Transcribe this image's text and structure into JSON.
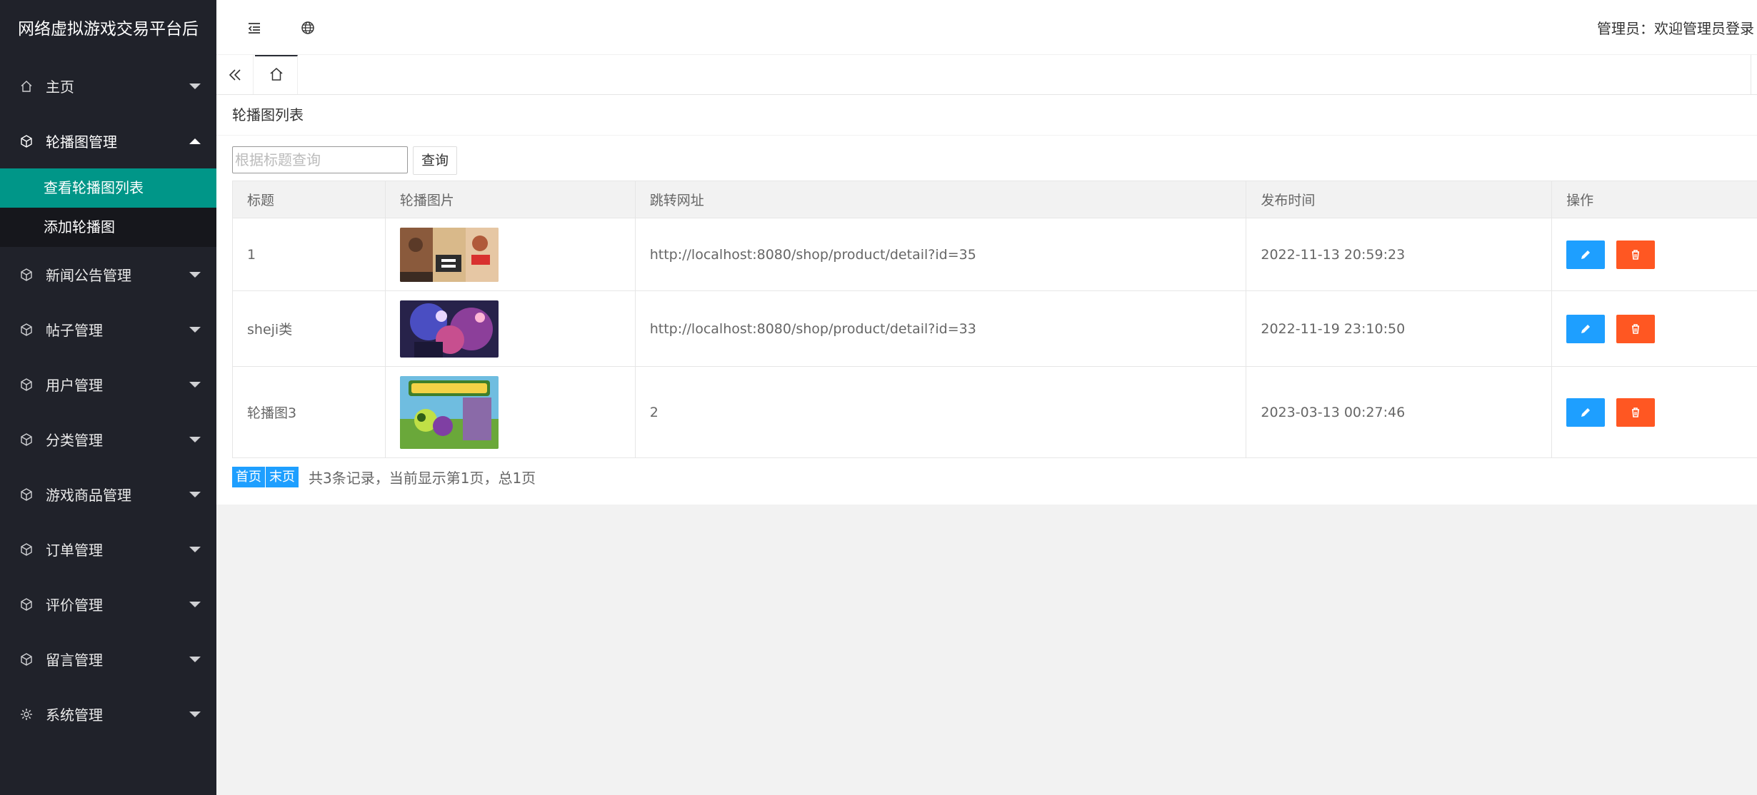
{
  "app": {
    "title": "网络虚拟游戏交易平台后"
  },
  "sidebar": {
    "items": [
      {
        "label": "主页"
      },
      {
        "label": "轮播图管理",
        "open": true,
        "children": [
          {
            "label": "查看轮播图列表",
            "active": true
          },
          {
            "label": "添加轮播图"
          }
        ]
      },
      {
        "label": "新闻公告管理"
      },
      {
        "label": "帖子管理"
      },
      {
        "label": "用户管理"
      },
      {
        "label": "分类管理"
      },
      {
        "label": "游戏商品管理"
      },
      {
        "label": "订单管理"
      },
      {
        "label": "评价管理"
      },
      {
        "label": "留言管理"
      },
      {
        "label": "系统管理"
      }
    ]
  },
  "header": {
    "user_text": "管理员：欢迎管理员登录"
  },
  "page": {
    "title": "轮播图列表",
    "search": {
      "placeholder": "根据标题查询",
      "value": "",
      "button": "查询"
    },
    "table": {
      "columns": [
        "标题",
        "轮播图片",
        "跳转网址",
        "发布时间",
        "操作"
      ],
      "rows": [
        {
          "title": "1",
          "image": "gta-cover",
          "url": "http://localhost:8080/shop/product/detail?id=35",
          "time": "2022-11-13 20:59:23"
        },
        {
          "title": "sheji类",
          "image": "heroes-cover",
          "url": "http://localhost:8080/shop/product/detail?id=33",
          "time": "2022-11-19 23:10:50"
        },
        {
          "title": "轮播图3",
          "image": "pvz-cover",
          "url": "2",
          "time": "2023-03-13 00:27:46"
        }
      ]
    },
    "pager": {
      "first": "首页",
      "last": "末页",
      "info": "共3条记录，当前显示第1页，总1页"
    }
  },
  "colors": {
    "sidebar": "#20222a",
    "accent": "#009688",
    "edit": "#1e9fff",
    "delete": "#ff5722"
  },
  "icons": {
    "menu": "indent-icon",
    "globe": "globe-icon",
    "home": "home-icon",
    "prev": "double-chevron-left-icon",
    "edit": "pencil-icon",
    "delete": "trash-icon"
  }
}
